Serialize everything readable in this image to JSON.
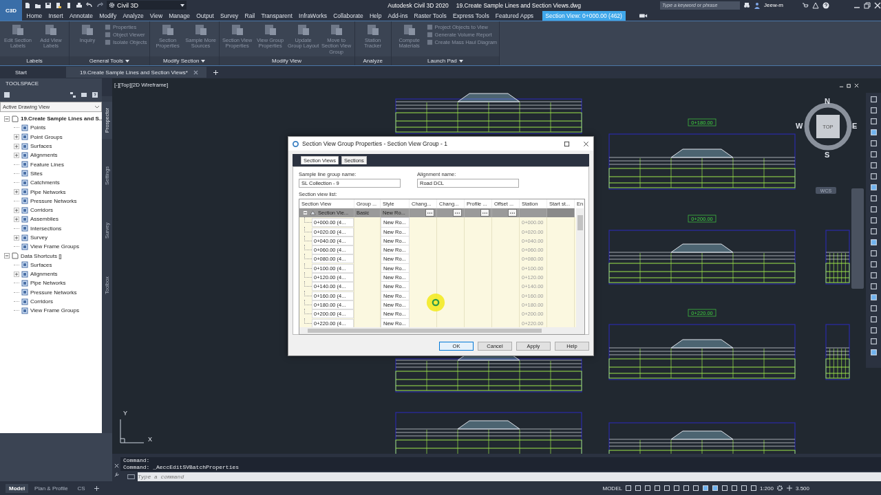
{
  "title_bar": {
    "app_button": "C3D",
    "workspace": "Civil 3D",
    "app_name": "Autodesk Civil 3D 2020",
    "file_name": "19.Create Sample Lines and Section Views.dwg",
    "search_placeholder": "Type a keyword or phrase",
    "user": "Jeew-m"
  },
  "ribbon_tabs": [
    {
      "label": "Home",
      "selected": false
    },
    {
      "label": "Insert",
      "selected": false
    },
    {
      "label": "Annotate",
      "selected": false
    },
    {
      "label": "Modify",
      "selected": false
    },
    {
      "label": "Analyze",
      "selected": false
    },
    {
      "label": "View",
      "selected": false
    },
    {
      "label": "Manage",
      "selected": false
    },
    {
      "label": "Output",
      "selected": false
    },
    {
      "label": "Survey",
      "selected": false
    },
    {
      "label": "Rail",
      "selected": false
    },
    {
      "label": "Transparent",
      "selected": false
    },
    {
      "label": "InfraWorks",
      "selected": false
    },
    {
      "label": "Collaborate",
      "selected": false
    },
    {
      "label": "Help",
      "selected": false
    },
    {
      "label": "Add-ins",
      "selected": false
    },
    {
      "label": "Raster Tools",
      "selected": false
    },
    {
      "label": "Express Tools",
      "selected": false
    },
    {
      "label": "Featured Apps",
      "selected": false
    },
    {
      "label": "Section View: 0+000.00 (462)",
      "selected": true
    }
  ],
  "ribbon_panels": [
    {
      "title": "Labels",
      "has_menu": false,
      "tools": [
        {
          "kind": "large",
          "label": "Edit Section Labels"
        },
        {
          "kind": "large",
          "label": "Add View Labels"
        }
      ]
    },
    {
      "title": "General Tools",
      "has_menu": true,
      "tools": [
        {
          "kind": "large",
          "label": "Inquiry"
        },
        {
          "kind": "small",
          "label": "Properties"
        },
        {
          "kind": "small",
          "label": "Object Viewer"
        },
        {
          "kind": "small",
          "label": "Isolate Objects"
        }
      ]
    },
    {
      "title": "Modify Section",
      "has_menu": true,
      "tools": [
        {
          "kind": "large",
          "label": "Section Properties"
        },
        {
          "kind": "large",
          "label": "Sample More Sources"
        }
      ]
    },
    {
      "title": "Modify View",
      "has_menu": false,
      "tools": [
        {
          "kind": "large",
          "label": "Section View Properties"
        },
        {
          "kind": "large",
          "label": "View Group Properties"
        },
        {
          "kind": "large",
          "label": "Update Group Layout"
        },
        {
          "kind": "large",
          "label": "Move to Section View Group"
        }
      ]
    },
    {
      "title": "Analyze",
      "has_menu": false,
      "tools": [
        {
          "kind": "large",
          "label": "Station Tracker"
        }
      ]
    },
    {
      "title": "Launch Pad",
      "has_menu": true,
      "tools": [
        {
          "kind": "large",
          "label": "Compute Materials"
        },
        {
          "kind": "small",
          "label": "Project Objects to View"
        },
        {
          "kind": "small",
          "label": "Generate Volume Report"
        },
        {
          "kind": "small",
          "label": "Create Mass Haul Diagram"
        }
      ]
    }
  ],
  "doc_tabs": [
    {
      "label": "Start",
      "selected": false
    },
    {
      "label": "19.Create Sample Lines and Section Views*",
      "selected": true
    }
  ],
  "toolspace": {
    "title": "TOOLSPACE",
    "view": "Active Drawing View",
    "tree": [
      {
        "label": "19.Create Sample Lines and S...",
        "expanded": true,
        "children": [
          {
            "label": "Points",
            "expandable": false
          },
          {
            "label": "Point Groups",
            "expandable": true
          },
          {
            "label": "Surfaces",
            "expandable": true
          },
          {
            "label": "Alignments",
            "expandable": true
          },
          {
            "label": "Feature Lines",
            "expandable": false
          },
          {
            "label": "Sites",
            "expandable": false
          },
          {
            "label": "Catchments",
            "expandable": false
          },
          {
            "label": "Pipe Networks",
            "expandable": true
          },
          {
            "label": "Pressure Networks",
            "expandable": false
          },
          {
            "label": "Corridors",
            "expandable": true
          },
          {
            "label": "Assemblies",
            "expandable": true
          },
          {
            "label": "Intersections",
            "expandable": false
          },
          {
            "label": "Survey",
            "expandable": true
          },
          {
            "label": "View Frame Groups",
            "expandable": false
          }
        ]
      },
      {
        "label": "Data Shortcuts []",
        "expanded": true,
        "children": [
          {
            "label": "Surfaces",
            "expandable": false
          },
          {
            "label": "Alignments",
            "expandable": true
          },
          {
            "label": "Pipe Networks",
            "expandable": false
          },
          {
            "label": "Pressure Networks",
            "expandable": false
          },
          {
            "label": "Corridors",
            "expandable": false
          },
          {
            "label": "View Frame Groups",
            "expandable": false
          }
        ]
      }
    ],
    "side_tabs": [
      {
        "label": "Prospector",
        "selected": true
      },
      {
        "label": "Settings",
        "selected": false
      },
      {
        "label": "Survey",
        "selected": false
      },
      {
        "label": "Toolbox",
        "selected": false
      }
    ]
  },
  "viewport": {
    "label": "[-][Top][2D Wireframe]",
    "station_labels": [
      "0+180.00",
      "0+200.00",
      "0+220.00"
    ],
    "viewcube": {
      "face": "TOP",
      "north": "N",
      "south": "S",
      "east": "E",
      "west": "W",
      "ucs": "WCS"
    },
    "axes": {
      "y": "Y",
      "x": "X"
    }
  },
  "dialog": {
    "title": "Section View Group Properties - Section View Group - 1",
    "tabs": [
      {
        "label": "Section Views",
        "selected": true
      },
      {
        "label": "Sections",
        "selected": false
      }
    ],
    "sample_line_group": {
      "label": "Sample line group name:",
      "value": "SL Collection - 9"
    },
    "alignment": {
      "label": "Alignment name:",
      "value": "Road DCL"
    },
    "list_label": "Section view list:",
    "columns": [
      "Section View",
      "Group ...",
      "Style",
      "Chang...",
      "Chang...",
      "Profile ...",
      "Offset ...",
      "Station",
      "Start st...",
      "En"
    ],
    "group_row": {
      "name": "Section Vie...",
      "group": "Basic",
      "style": "New Ro...",
      "expanded": true
    },
    "rows": [
      {
        "name": "0+000.00 (4...",
        "style": "New Ro...",
        "station": "0+000.00"
      },
      {
        "name": "0+020.00 (4...",
        "style": "New Ro...",
        "station": "0+020.00"
      },
      {
        "name": "0+040.00 (4...",
        "style": "New Ro...",
        "station": "0+040.00"
      },
      {
        "name": "0+060.00 (4...",
        "style": "New Ro...",
        "station": "0+060.00"
      },
      {
        "name": "0+080.00 (4...",
        "style": "New Ro...",
        "station": "0+080.00"
      },
      {
        "name": "0+100.00 (4...",
        "style": "New Ro...",
        "station": "0+100.00"
      },
      {
        "name": "0+120.00 (4...",
        "style": "New Ro...",
        "station": "0+120.00"
      },
      {
        "name": "0+140.00 (4...",
        "style": "New Ro...",
        "station": "0+140.00"
      },
      {
        "name": "0+160.00 (4...",
        "style": "New Ro...",
        "station": "0+160.00"
      },
      {
        "name": "0+180.00 (4...",
        "style": "New Ro...",
        "station": "0+180.00"
      },
      {
        "name": "0+200.00 (4...",
        "style": "New Ro...",
        "station": "0+200.00"
      },
      {
        "name": "0+220.00 (4...",
        "style": "New Ro...",
        "station": "0+220.00"
      }
    ],
    "buttons": [
      {
        "label": "OK",
        "default": true
      },
      {
        "label": "Cancel",
        "default": false
      },
      {
        "label": "Apply",
        "default": false
      },
      {
        "label": "Help",
        "default": false
      }
    ]
  },
  "command_line": {
    "history": [
      "Command:",
      "Command:  _AeccEditSVBatchProperties"
    ],
    "placeholder": "Type a command"
  },
  "status_bar": {
    "layout_tabs": [
      {
        "label": "Model",
        "selected": true
      },
      {
        "label": "Plan & Profile",
        "selected": false
      },
      {
        "label": "CS",
        "selected": false
      }
    ],
    "space": "MODEL",
    "scale": "1:200",
    "value": "3.500"
  }
}
